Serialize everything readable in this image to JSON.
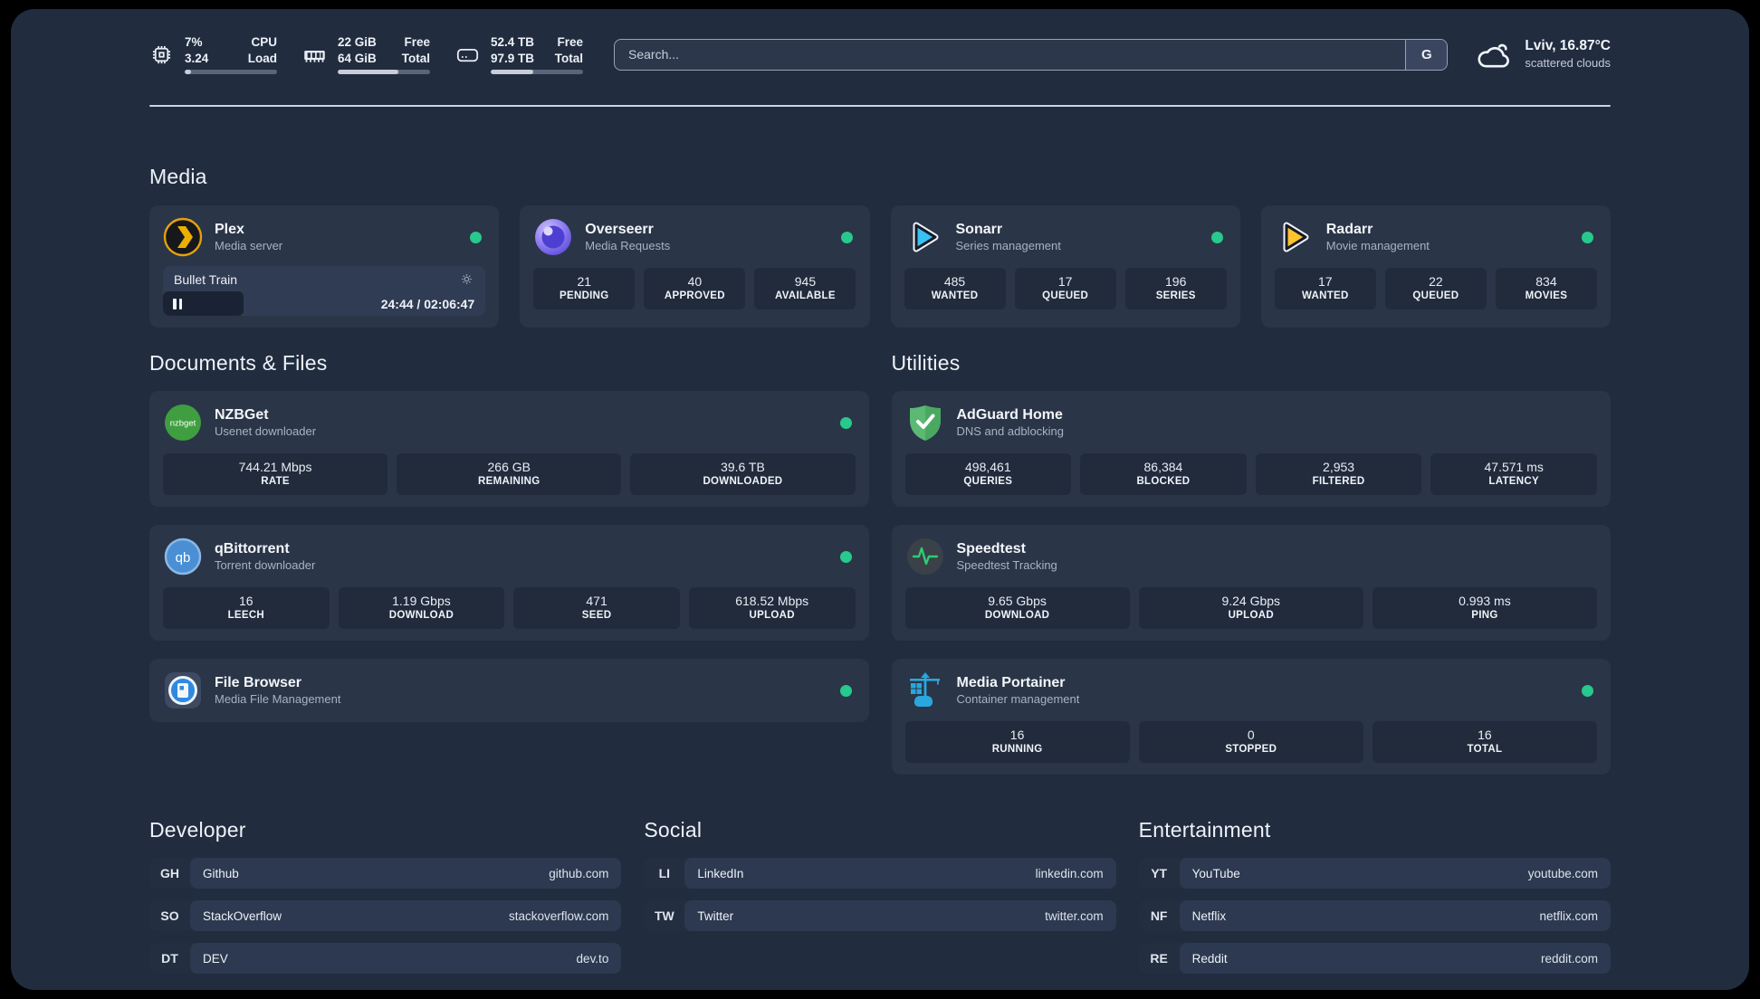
{
  "colors": {
    "status_online": "#27c98c"
  },
  "header": {
    "stats": {
      "cpu": {
        "value1": "7%",
        "value2": "3.24",
        "label1": "CPU",
        "label2": "Load",
        "progress": 7
      },
      "memory": {
        "value1": "22 GiB",
        "value2": "64 GiB",
        "label1": "Free",
        "label2": "Total",
        "progress": 66
      },
      "disk": {
        "value1": "52.4 TB",
        "value2": "97.9 TB",
        "label1": "Free",
        "label2": "Total",
        "progress": 46
      }
    },
    "search": {
      "placeholder": "Search...",
      "engine_label": "G"
    },
    "weather": {
      "location": "Lviv, 16.87°C",
      "condition": "scattered clouds"
    }
  },
  "sections": {
    "media": "Media",
    "documents": "Documents & Files",
    "utilities": "Utilities",
    "developer": "Developer",
    "social": "Social",
    "entertainment": "Entertainment"
  },
  "apps": {
    "plex": {
      "name": "Plex",
      "description": "Media server",
      "now_playing": {
        "title": "Bullet Train",
        "time": "24:44 / 02:06:47",
        "progress": 25
      }
    },
    "overseerr": {
      "name": "Overseerr",
      "description": "Media Requests",
      "stats": [
        {
          "value": "21",
          "label": "PENDING"
        },
        {
          "value": "40",
          "label": "APPROVED"
        },
        {
          "value": "945",
          "label": "AVAILABLE"
        }
      ]
    },
    "sonarr": {
      "name": "Sonarr",
      "description": "Series management",
      "stats": [
        {
          "value": "485",
          "label": "WANTED"
        },
        {
          "value": "17",
          "label": "QUEUED"
        },
        {
          "value": "196",
          "label": "SERIES"
        }
      ]
    },
    "radarr": {
      "name": "Radarr",
      "description": "Movie management",
      "stats": [
        {
          "value": "17",
          "label": "WANTED"
        },
        {
          "value": "22",
          "label": "QUEUED"
        },
        {
          "value": "834",
          "label": "MOVIES"
        }
      ]
    },
    "nzbget": {
      "name": "NZBGet",
      "description": "Usenet downloader",
      "stats": [
        {
          "value": "744.21 Mbps",
          "label": "RATE"
        },
        {
          "value": "266 GB",
          "label": "REMAINING"
        },
        {
          "value": "39.6 TB",
          "label": "DOWNLOADED"
        }
      ]
    },
    "qbittorrent": {
      "name": "qBittorrent",
      "description": "Torrent downloader",
      "stats": [
        {
          "value": "16",
          "label": "LEECH"
        },
        {
          "value": "1.19 Gbps",
          "label": "DOWNLOAD"
        },
        {
          "value": "471",
          "label": "SEED"
        },
        {
          "value": "618.52 Mbps",
          "label": "UPLOAD"
        }
      ]
    },
    "filebrowser": {
      "name": "File Browser",
      "description": "Media File Management"
    },
    "adguard": {
      "name": "AdGuard Home",
      "description": "DNS and adblocking",
      "stats": [
        {
          "value": "498,461",
          "label": "QUERIES"
        },
        {
          "value": "86,384",
          "label": "BLOCKED"
        },
        {
          "value": "2,953",
          "label": "FILTERED"
        },
        {
          "value": "47.571 ms",
          "label": "LATENCY"
        }
      ]
    },
    "speedtest": {
      "name": "Speedtest",
      "description": "Speedtest Tracking",
      "stats": [
        {
          "value": "9.65 Gbps",
          "label": "DOWNLOAD"
        },
        {
          "value": "9.24 Gbps",
          "label": "UPLOAD"
        },
        {
          "value": "0.993 ms",
          "label": "PING"
        }
      ]
    },
    "portainer": {
      "name": "Media Portainer",
      "description": "Container management",
      "stats": [
        {
          "value": "16",
          "label": "RUNNING"
        },
        {
          "value": "0",
          "label": "STOPPED"
        },
        {
          "value": "16",
          "label": "TOTAL"
        }
      ]
    }
  },
  "bookmarks": {
    "developer": [
      {
        "abbr": "GH",
        "name": "Github",
        "url": "github.com"
      },
      {
        "abbr": "SO",
        "name": "StackOverflow",
        "url": "stackoverflow.com"
      },
      {
        "abbr": "DT",
        "name": "DEV",
        "url": "dev.to"
      }
    ],
    "social": [
      {
        "abbr": "LI",
        "name": "LinkedIn",
        "url": "linkedin.com"
      },
      {
        "abbr": "TW",
        "name": "Twitter",
        "url": "twitter.com"
      }
    ],
    "entertainment": [
      {
        "abbr": "YT",
        "name": "YouTube",
        "url": "youtube.com"
      },
      {
        "abbr": "NF",
        "name": "Netflix",
        "url": "netflix.com"
      },
      {
        "abbr": "RE",
        "name": "Reddit",
        "url": "reddit.com"
      }
    ]
  }
}
